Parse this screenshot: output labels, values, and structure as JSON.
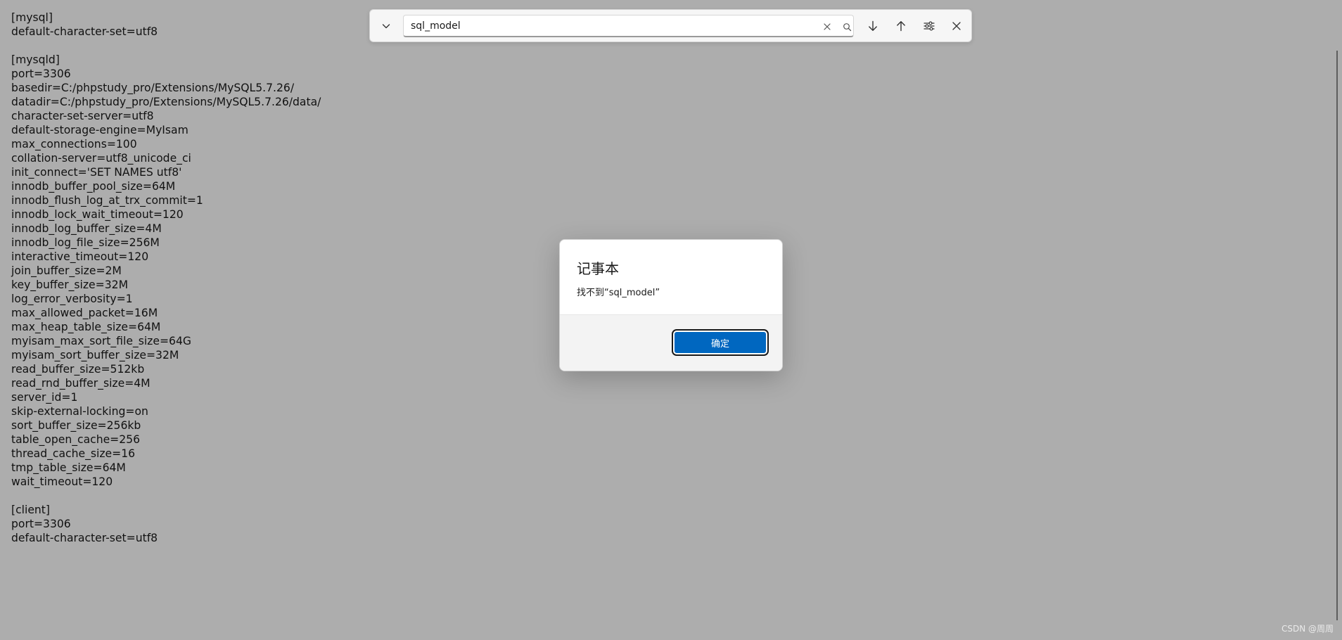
{
  "editor": {
    "content": "[mysql]\ndefault-character-set=utf8\n\n[mysqld]\nport=3306\nbasedir=C:/phpstudy_pro/Extensions/MySQL5.7.26/\ndatadir=C:/phpstudy_pro/Extensions/MySQL5.7.26/data/\ncharacter-set-server=utf8\ndefault-storage-engine=MyIsam\nmax_connections=100\ncollation-server=utf8_unicode_ci\ninit_connect='SET NAMES utf8'\ninnodb_buffer_pool_size=64M\ninnodb_flush_log_at_trx_commit=1\ninnodb_lock_wait_timeout=120\ninnodb_log_buffer_size=4M\ninnodb_log_file_size=256M\ninteractive_timeout=120\njoin_buffer_size=2M\nkey_buffer_size=32M\nlog_error_verbosity=1\nmax_allowed_packet=16M\nmax_heap_table_size=64M\nmyisam_max_sort_file_size=64G\nmyisam_sort_buffer_size=32M\nread_buffer_size=512kb\nread_rnd_buffer_size=4M\nserver_id=1\nskip-external-locking=on\nsort_buffer_size=256kb\ntable_open_cache=256\nthread_cache_size=16\ntmp_table_size=64M\nwait_timeout=120\n\n[client]\nport=3306\ndefault-character-set=utf8"
  },
  "find_bar": {
    "search_value": "sql_model",
    "icons": {
      "expand": "chevron-down-icon",
      "clear": "close-icon",
      "search": "search-icon",
      "next": "arrow-down-icon",
      "previous": "arrow-up-icon",
      "options": "sliders-icon",
      "close": "close-icon"
    }
  },
  "dialog": {
    "title": "记事本",
    "message": "找不到“sql_model”",
    "ok_label": "确定",
    "accent_color": "#0067c0"
  },
  "watermark": "CSDN @周周"
}
